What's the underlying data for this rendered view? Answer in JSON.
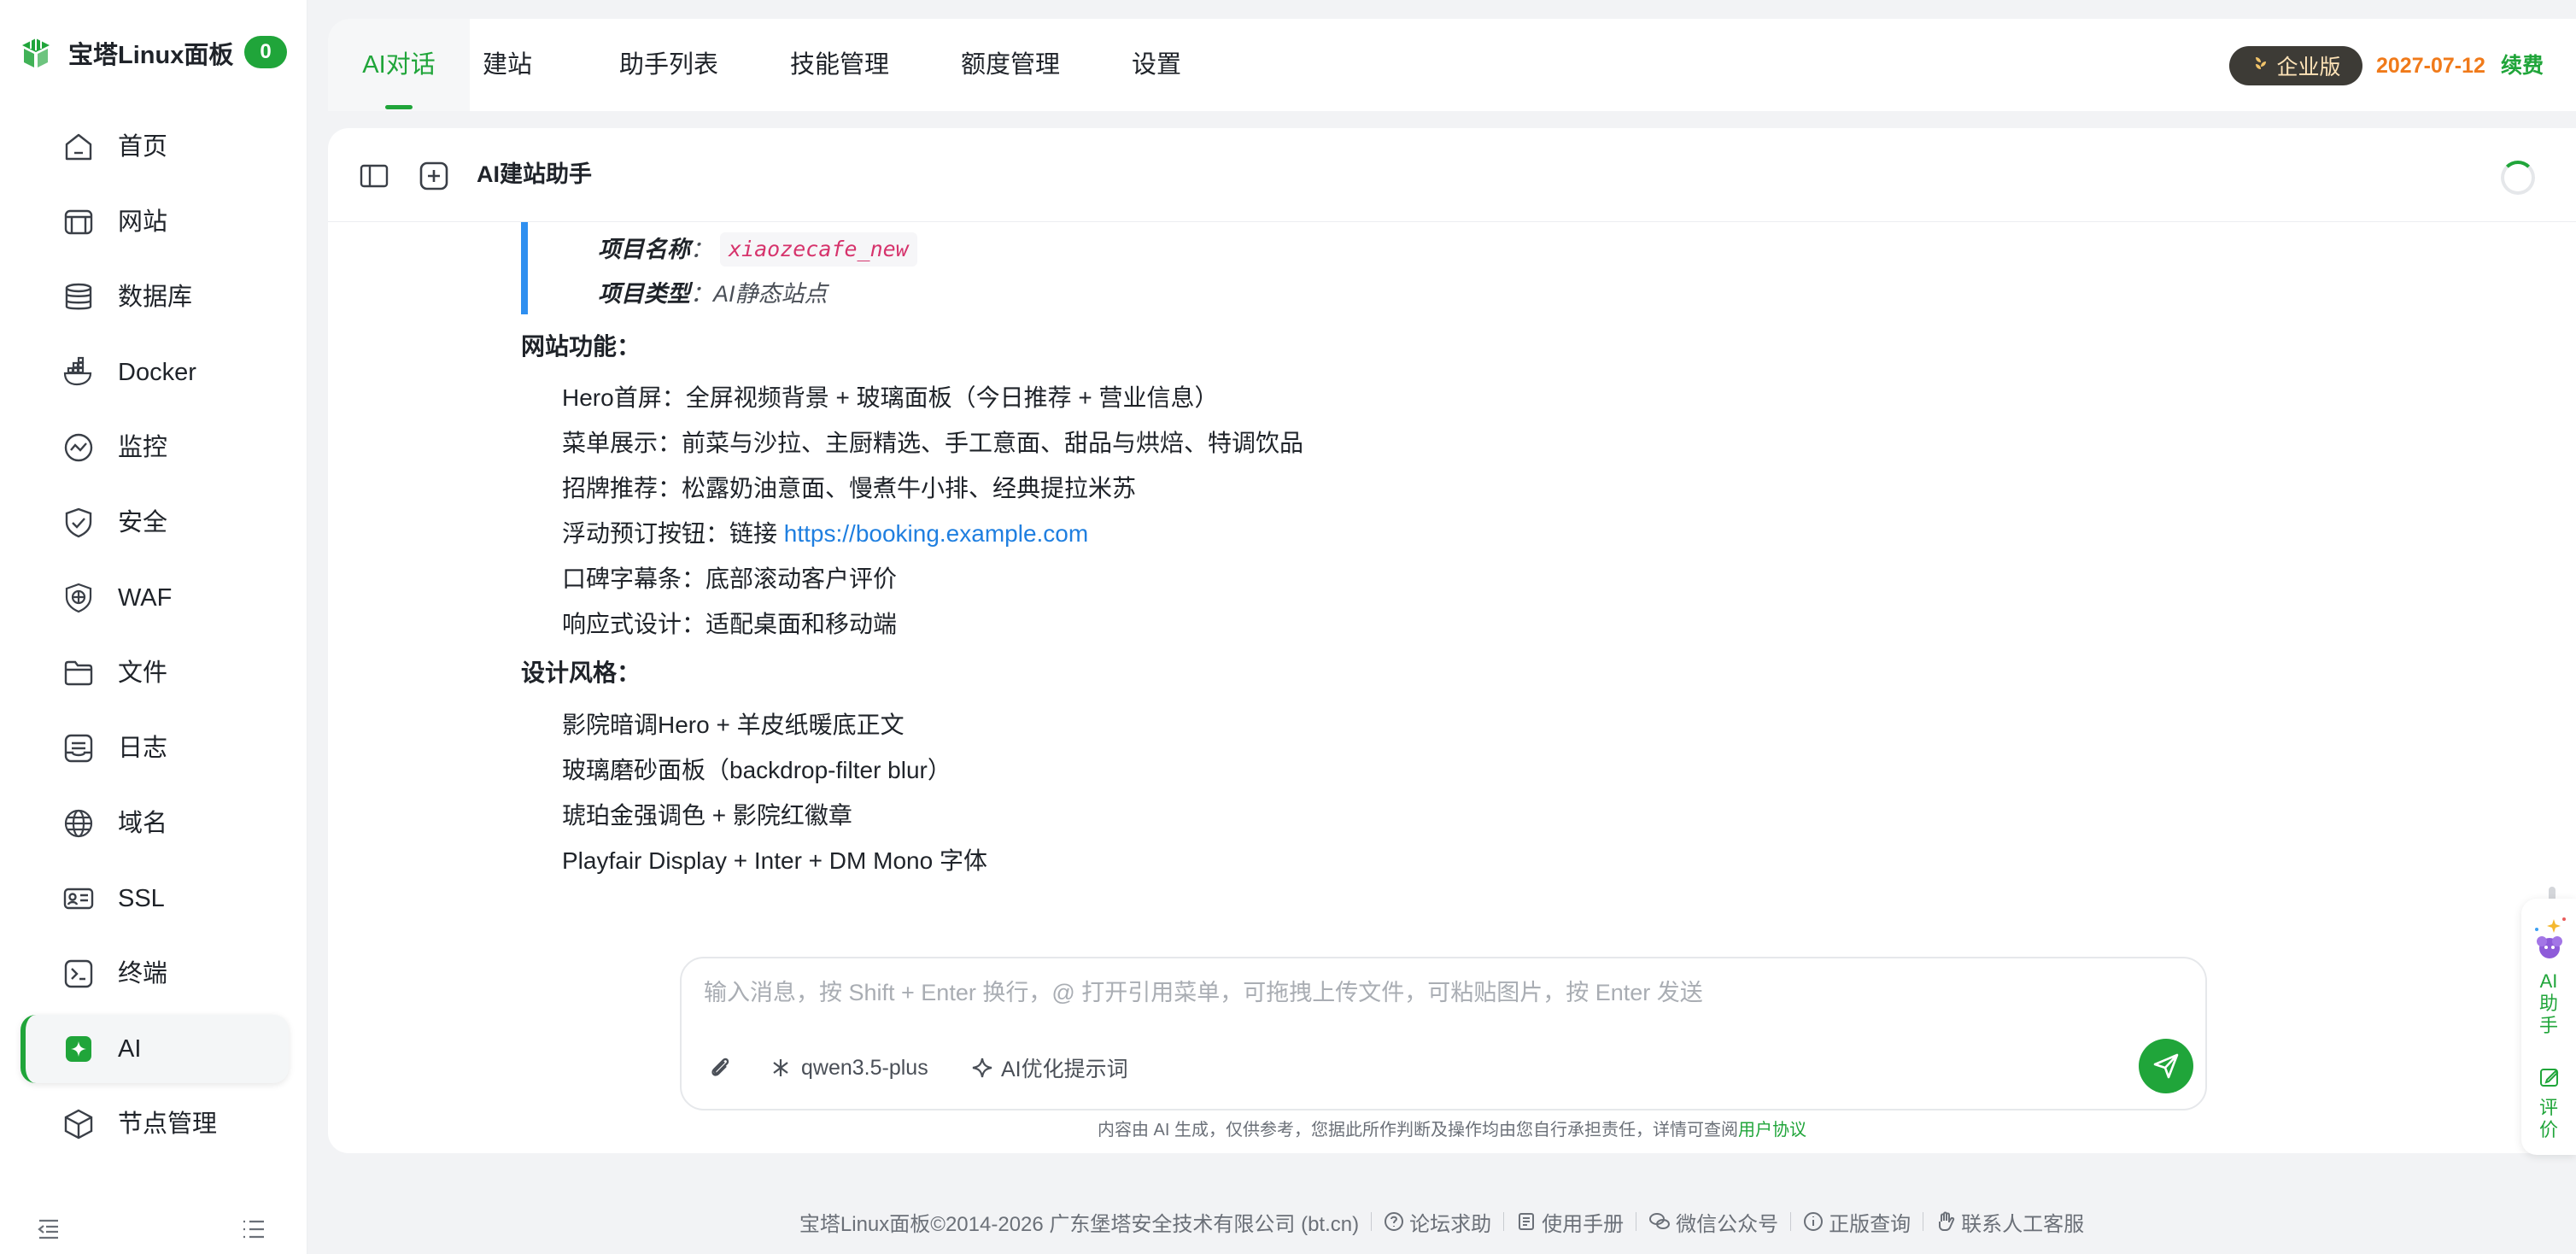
{
  "brand": {
    "title": "宝塔Linux面板",
    "badge": "0"
  },
  "sidebar": {
    "items": [
      {
        "label": "首页",
        "icon": "home-icon"
      },
      {
        "label": "网站",
        "icon": "website-icon"
      },
      {
        "label": "数据库",
        "icon": "database-icon"
      },
      {
        "label": "Docker",
        "icon": "docker-icon"
      },
      {
        "label": "监控",
        "icon": "monitor-icon"
      },
      {
        "label": "安全",
        "icon": "shield-icon"
      },
      {
        "label": "WAF",
        "icon": "waf-icon"
      },
      {
        "label": "文件",
        "icon": "folder-icon"
      },
      {
        "label": "日志",
        "icon": "log-icon"
      },
      {
        "label": "域名",
        "icon": "globe-icon"
      },
      {
        "label": "SSL",
        "icon": "ssl-icon"
      },
      {
        "label": "终端",
        "icon": "terminal-icon"
      },
      {
        "label": "AI",
        "icon": "ai-icon",
        "active": true
      },
      {
        "label": "节点管理",
        "icon": "cube-icon"
      }
    ]
  },
  "tabs": [
    {
      "label": "AI对话",
      "active": true
    },
    {
      "label": "建站"
    },
    {
      "label": "助手列表"
    },
    {
      "label": "技能管理"
    },
    {
      "label": "额度管理"
    },
    {
      "label": "设置"
    }
  ],
  "account": {
    "edition": "企业版",
    "expire_date": "2027-07-12",
    "renew": "续费"
  },
  "chat": {
    "title": "AI建站助手",
    "meta": [
      {
        "key": "项目名称",
        "value": "xiaozecafe_new",
        "is_code": true
      },
      {
        "key": "项目类型",
        "value": "AI静态站点",
        "is_code": false
      }
    ],
    "features_title": "网站功能：",
    "features": [
      "Hero首屏：全屏视频背景 + 玻璃面板（今日推荐 + 营业信息）",
      "菜单展示：前菜与沙拉、主厨精选、手工意面、甜品与烘焙、特调饮品",
      "招牌推荐：松露奶油意面、慢煮牛小排、经典提拉米苏",
      "浮动预订按钮：链接 ",
      "口碑字幕条：底部滚动客户评价",
      "响应式设计：适配桌面和移动端"
    ],
    "booking_link": "https://booking.example.com",
    "style_title": "设计风格：",
    "styles": [
      "影院暗调Hero + 羊皮纸暖底正文",
      "玻璃磨砂面板（backdrop-filter blur）",
      "琥珀金强调色 + 影院红徽章",
      "Playfair Display + Inter + DM Mono 字体"
    ]
  },
  "input": {
    "placeholder": "输入消息，按 Shift + Enter 换行，@ 打开引用菜单，可拖拽上传文件，可粘贴图片，按 Enter 发送",
    "model": "qwen3.5-plus",
    "optimize": "AI优化提示词"
  },
  "disclaimer": {
    "text": "内容由 AI 生成，仅供参考，您据此所作判断及操作均由您自行承担责任，详情可查阅",
    "link": "用户协议"
  },
  "helper": {
    "ai_label": "AI助手",
    "rate_label": "评价"
  },
  "footer": {
    "copyright": "宝塔Linux面板©2014-2026 广东堡塔安全技术有限公司 (bt.cn)",
    "links": [
      "论坛求助",
      "使用手册",
      "微信公众号",
      "正版查询",
      "联系人工客服"
    ]
  },
  "colors": {
    "brand_green": "#20a53a",
    "link_blue": "#1f7fe0",
    "expire_orange": "#f07a1a",
    "quote_blue": "#2e8ff0"
  }
}
